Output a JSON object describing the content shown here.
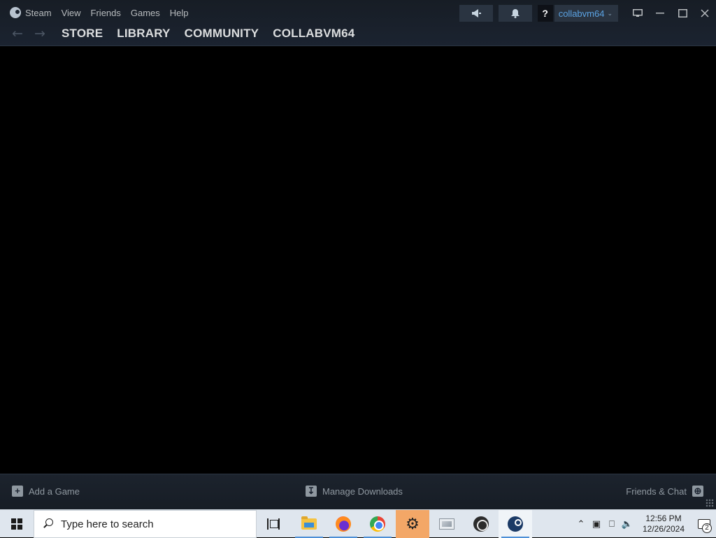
{
  "menubar": {
    "app_name": "Steam",
    "items": [
      "View",
      "Friends",
      "Games",
      "Help"
    ]
  },
  "navbar": {
    "back_icon": "arrow-left-icon",
    "forward_icon": "arrow-right-icon",
    "links": [
      "STORE",
      "LIBRARY",
      "COMMUNITY",
      "COLLABVM64"
    ]
  },
  "top_controls": {
    "help_label": "?",
    "account_name": "collabvm64",
    "account_accent": "#5ba3e3"
  },
  "bottombar": {
    "add_game": "Add a Game",
    "manage_downloads": "Manage Downloads",
    "friends_chat": "Friends & Chat"
  },
  "taskbar": {
    "search_placeholder": "Type here to search",
    "clock_time": "12:56 PM",
    "clock_date": "12/26/2024",
    "notification_count": "2"
  }
}
